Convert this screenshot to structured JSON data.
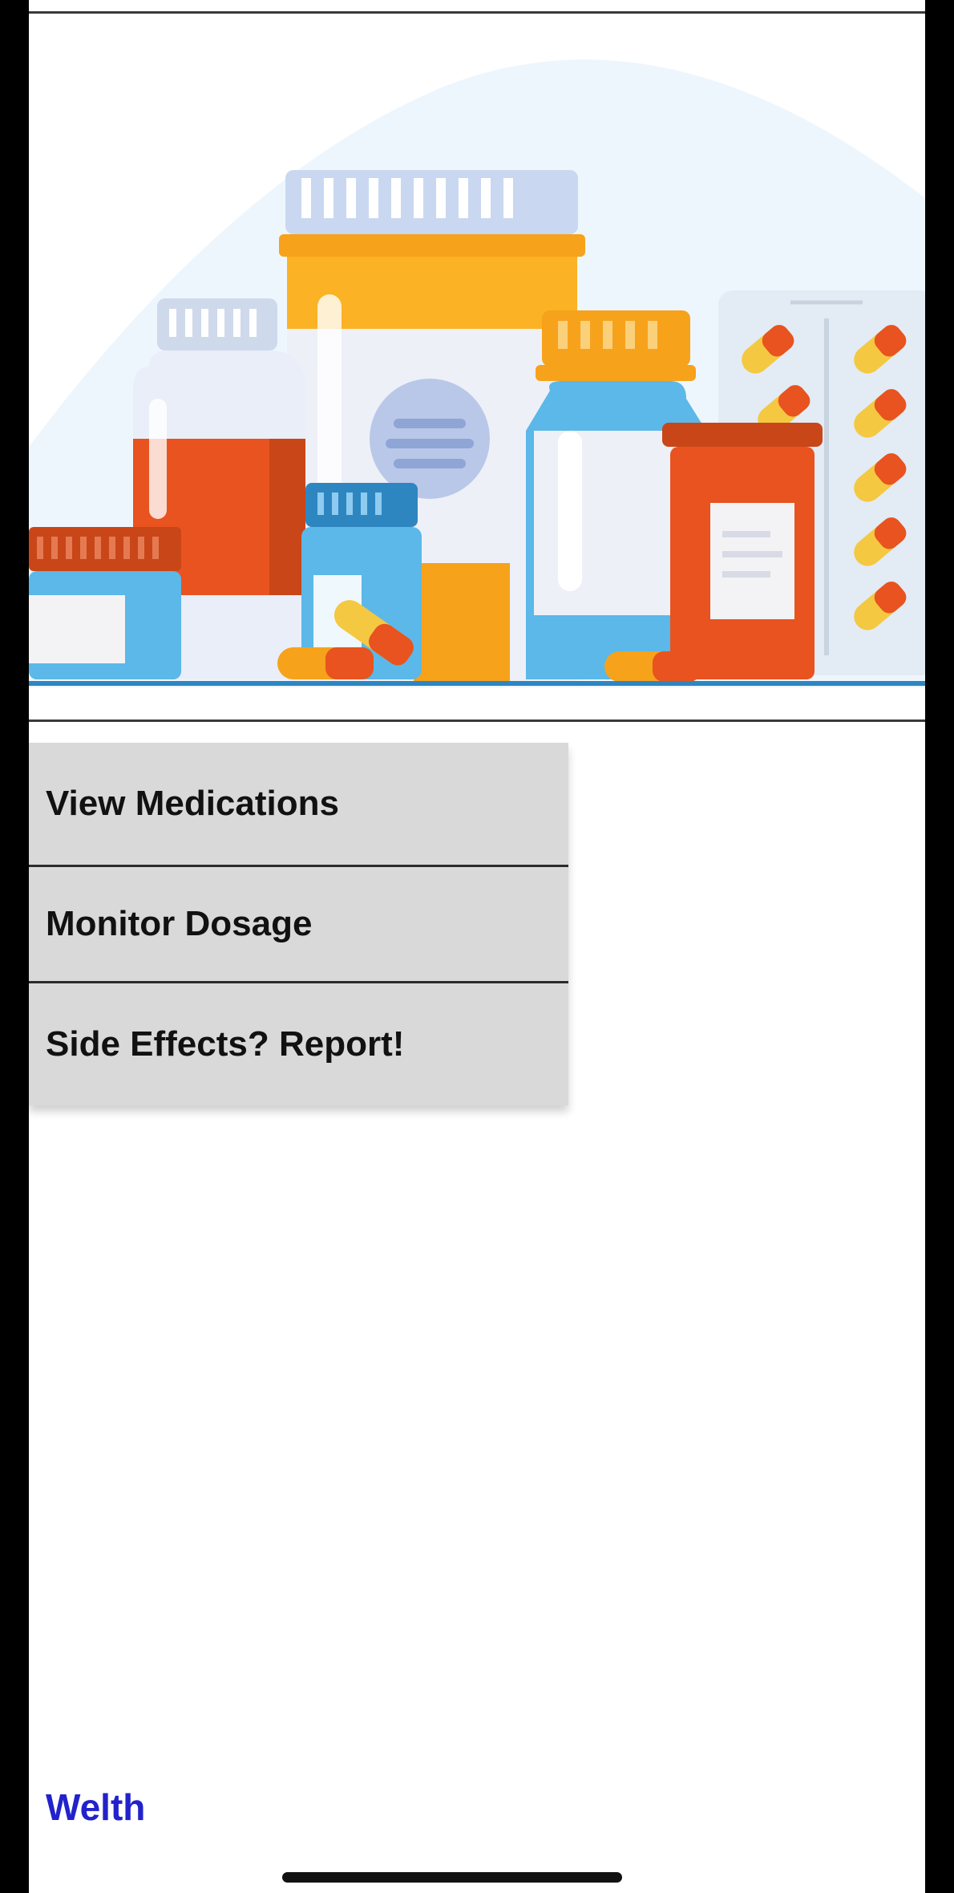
{
  "hero": {
    "illustration": "medicine-bottles-and-pills-illustration"
  },
  "menu": {
    "items": [
      {
        "label": "View Medications"
      },
      {
        "label": "Monitor Dosage"
      },
      {
        "label": "Side Effects? Report!"
      }
    ]
  },
  "footer": {
    "brand": "Welth",
    "brand_color": "#2222cc"
  },
  "colors": {
    "menu_bg": "#d9d9d9",
    "orange": "#f7a21b",
    "red": "#e8531f",
    "blue": "#5bb8e8"
  }
}
